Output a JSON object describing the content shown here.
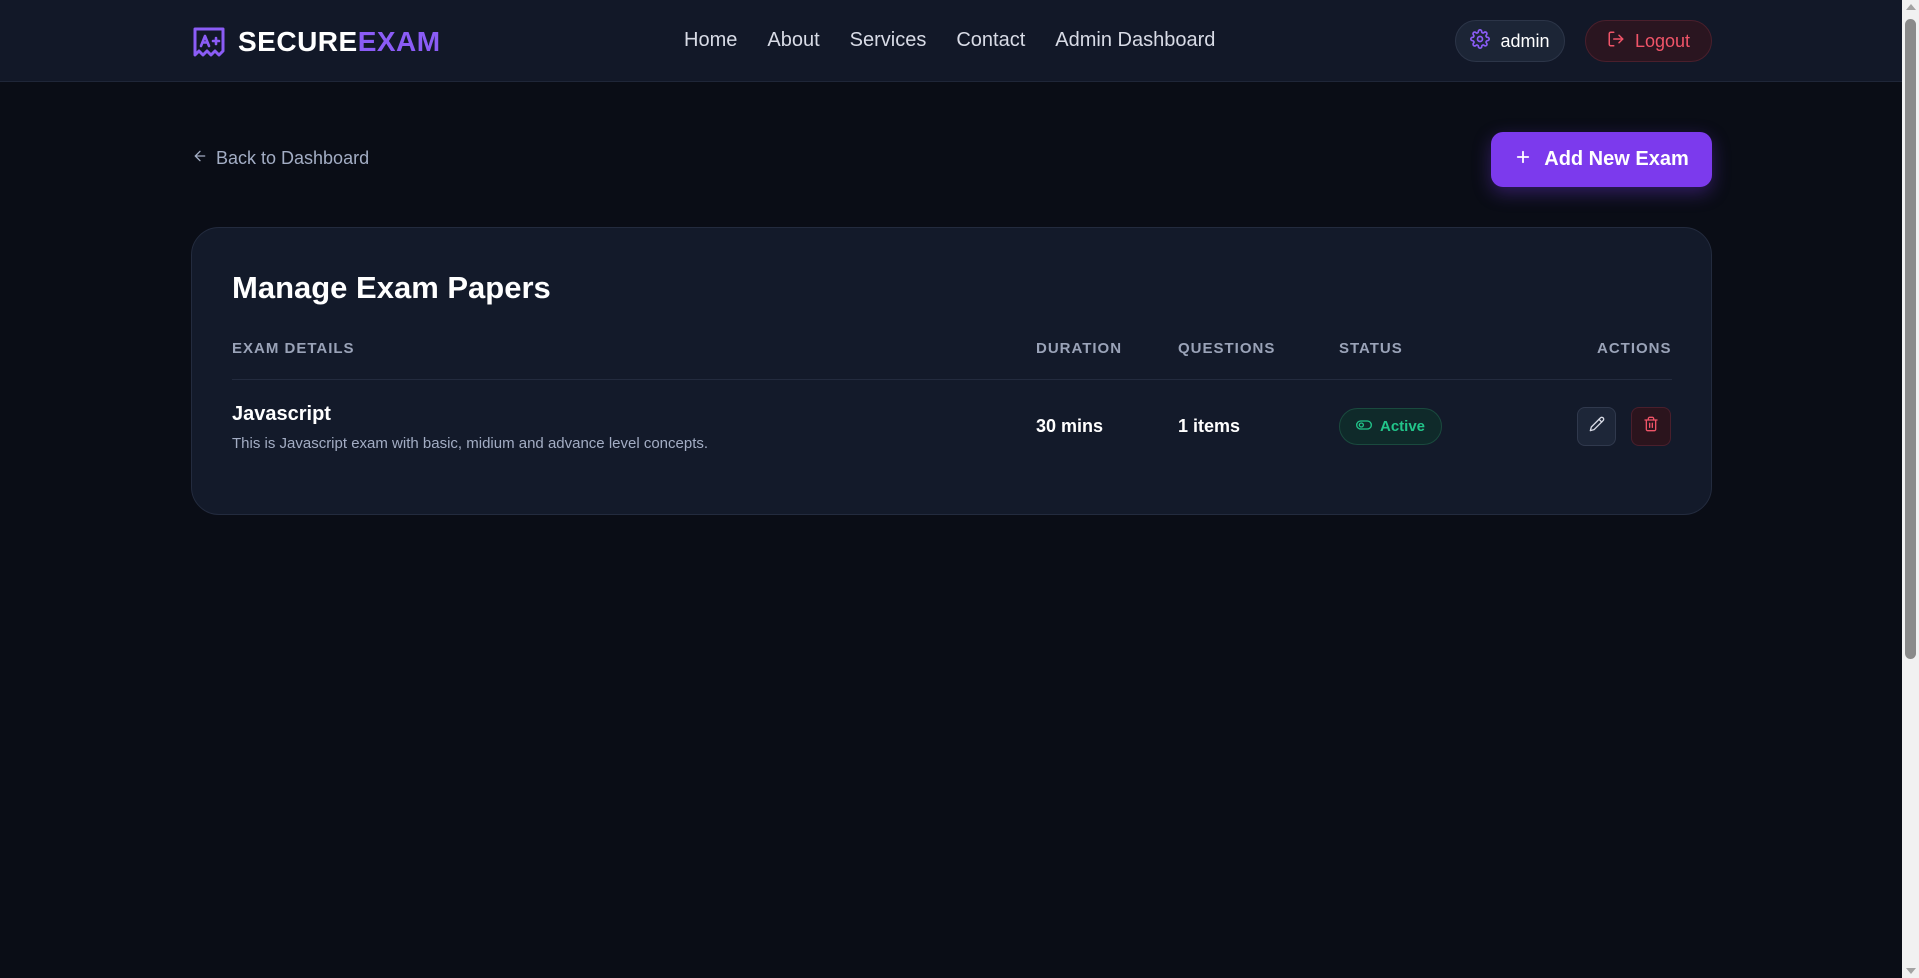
{
  "brand": {
    "name_part1": "SECURE",
    "name_part2": "EXAM"
  },
  "nav": {
    "links": [
      "Home",
      "About",
      "Services",
      "Contact",
      "Admin Dashboard"
    ]
  },
  "user": {
    "name": "admin",
    "logout_label": "Logout"
  },
  "page": {
    "back_label": "Back to Dashboard",
    "add_exam_label": "Add New Exam",
    "title": "Manage Exam Papers"
  },
  "table": {
    "headers": [
      "EXAM DETAILS",
      "DURATION",
      "QUESTIONS",
      "STATUS",
      "ACTIONS"
    ],
    "rows": [
      {
        "name": "Javascript",
        "description": "This is Javascript exam with basic, midium and advance level concepts.",
        "duration": "30 mins",
        "questions": "1 items",
        "status": "Active"
      }
    ]
  },
  "colors": {
    "accent": "#7c3aed",
    "brand_purple": "#8b5cf6",
    "danger": "#f05468",
    "success": "#22c58a",
    "background": "#0a0d16",
    "card": "#131a2a"
  },
  "icons": {
    "brand": "exam-paper-icon",
    "settings": "gear-icon",
    "logout": "logout-icon",
    "back": "arrow-left-icon",
    "add": "plus-icon",
    "status": "toggle-icon",
    "edit": "pencil-icon",
    "delete": "trash-icon"
  }
}
